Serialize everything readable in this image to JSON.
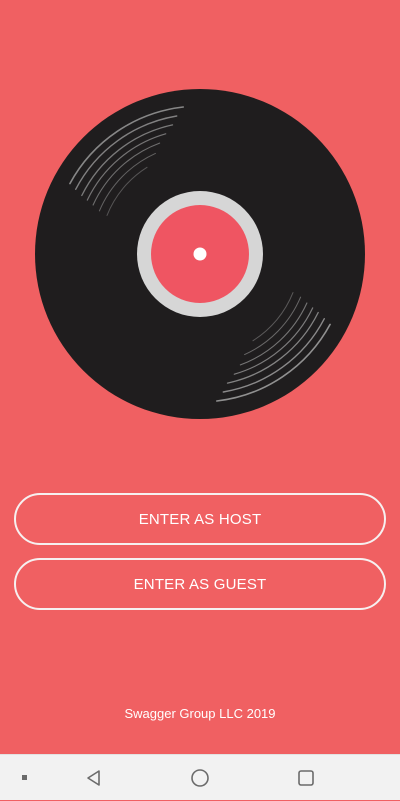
{
  "app": {
    "host_button_label": "ENTER AS HOST",
    "guest_button_label": "ENTER AS GUEST",
    "footer_text": "Swagger Group LLC 2019"
  },
  "colors": {
    "background": "#f06062",
    "record": "#1f1d1e",
    "label": "#ef5562",
    "label_ring": "#d6d6d6",
    "button_border": "#f6f0f0",
    "navbar": "#f2f2f2"
  },
  "icons": {
    "record": "vinyl-record-icon",
    "nav_menu": "menu-dot-icon",
    "nav_back": "back-triangle-icon",
    "nav_home": "home-circle-icon",
    "nav_recent": "recent-apps-square-icon"
  }
}
